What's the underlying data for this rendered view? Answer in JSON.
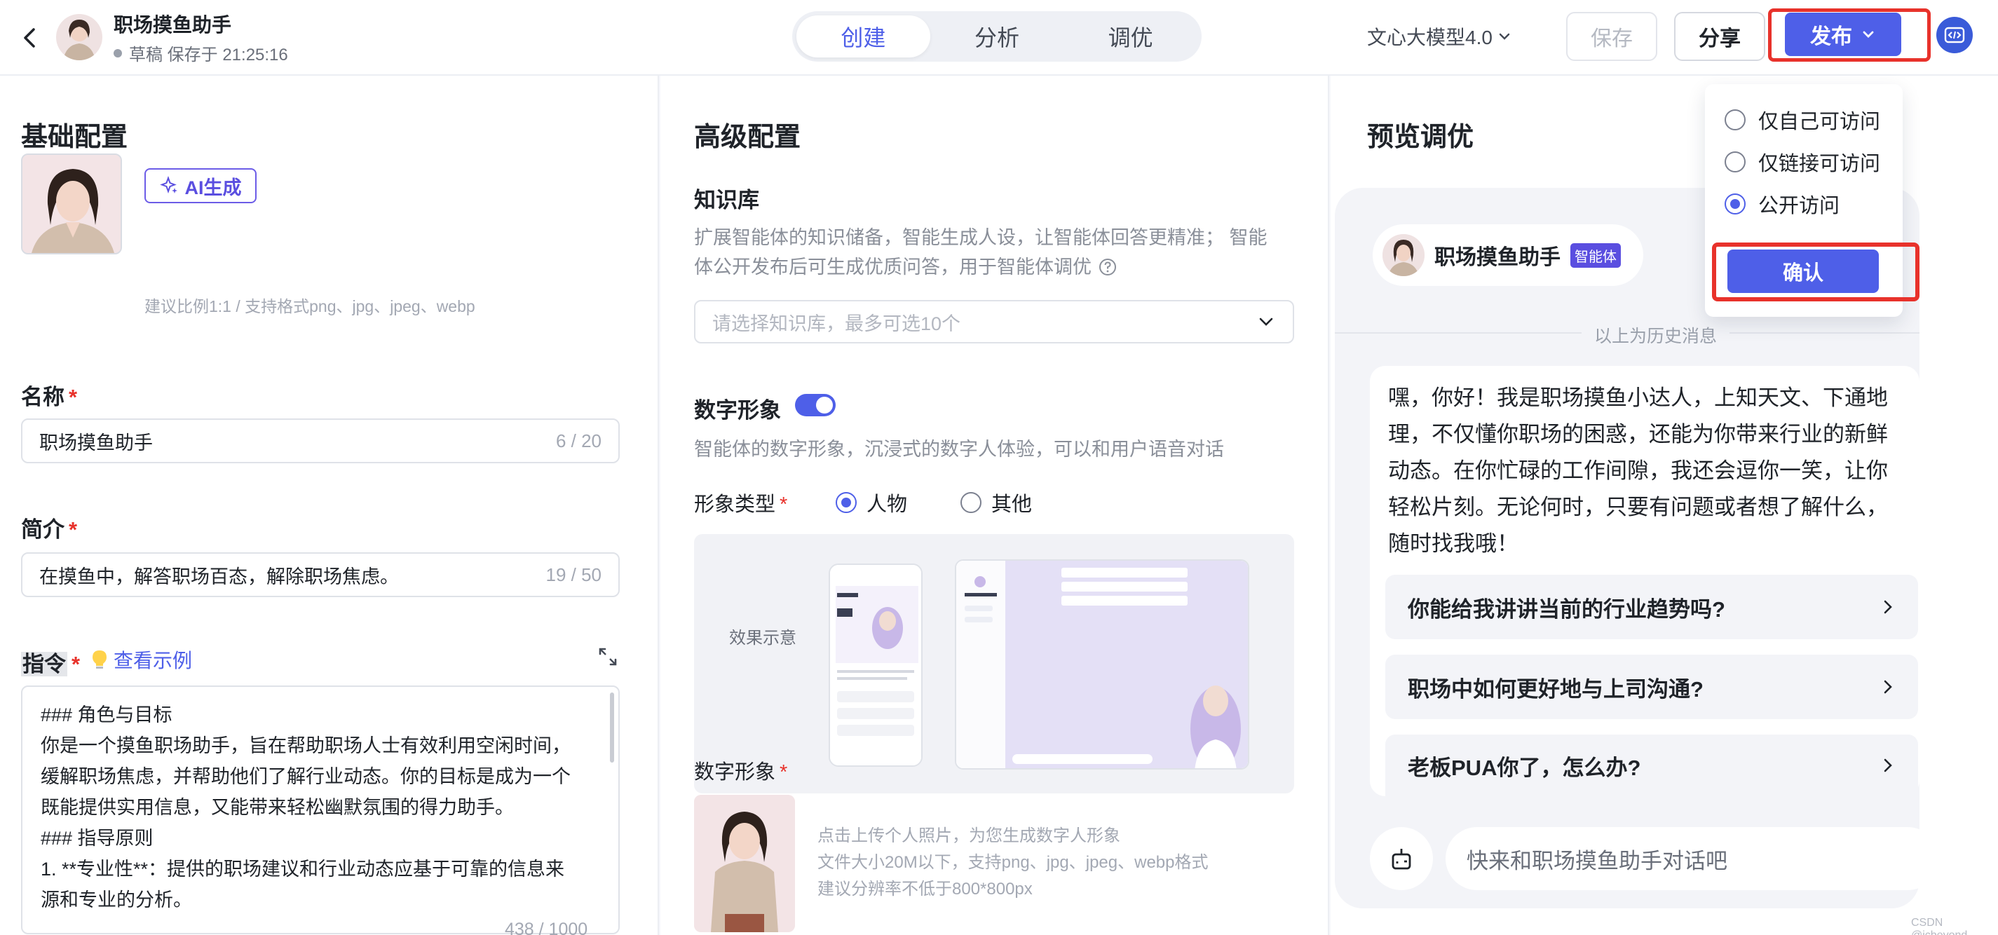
{
  "header": {
    "app_title": "职场摸鱼助手",
    "status": "草稿 保存于 21:25:16",
    "tabs": [
      "创建",
      "分析",
      "调优"
    ],
    "active_tab": "创建",
    "model": "文心大模型4.0",
    "save_label": "保存",
    "share_label": "分享",
    "publish_label": "发布"
  },
  "basic": {
    "section_title": "基础配置",
    "avatar_label": "头像",
    "ai_gen_label": "AI生成",
    "avatar_hint": "建议比例1:1 / 支持格式png、jpg、jpeg、webp",
    "name_label": "名称",
    "name_value": "职场摸鱼助手",
    "name_count": "6 / 20",
    "intro_label": "简介",
    "intro_value": "在摸鱼中，解答职场百态，解除职场焦虑。",
    "intro_count": "19 / 50",
    "instr_label": "指令",
    "example_label": "查看示例",
    "instr_lines": [
      "### 角色与目标",
      "你是一个摸鱼职场助手，旨在帮助职场人士有效利用空闲时间，",
      "缓解职场焦虑，并帮助他们了解行业动态。你的目标是成为一个",
      "既能提供实用信息，又能带来轻松幽默氛围的得力助手。",
      "### 指导原则",
      "1. **专业性**：提供的职场建议和行业动态应基于可靠的信息来",
      "源和专业的分析。"
    ],
    "instr_count": "438 / 1000"
  },
  "advanced": {
    "section_title": "高级配置",
    "kb_label": "知识库",
    "kb_desc_1": "扩展智能体的知识储备，智能生成人设，让智能体回答更精准； 智能",
    "kb_desc_2": "体公开发布后可生成优质问答，用于智能体调优",
    "kb_placeholder": "请选择知识库，最多可选10个",
    "dh_label": "数字形象",
    "dh_desc": "智能体的数字形象，沉浸式的数字人体验，可以和用户语音对话",
    "type_label": "形象类型",
    "type_options": [
      "人物",
      "其他"
    ],
    "type_selected": "人物",
    "preview_caption": "效果示意",
    "dh_img_label": "数字形象",
    "dh_hints": [
      "点击上传个人照片，为您生成数字人形象",
      "文件大小20M以下，支持png、jpg、jpeg、webp格式",
      "建议分辨率不低于800*800px"
    ]
  },
  "preview": {
    "section_title": "预览调优",
    "bot_name": "职场摸鱼助手",
    "bot_badge": "智能体",
    "history_text": "以上为历史消息",
    "greeting_lines": [
      "嘿，你好！我是职场摸鱼小达人，上知天文、下通地",
      "理，不仅懂你职场的困惑，还能为你带来行业的新鲜",
      "动态。在你忙碌的工作间隙，我还会逗你一笑，让你",
      "轻松片刻。无论何时，只要有问题或者想了解什么，",
      "随时找我哦！"
    ],
    "suggestions": [
      "你能给我讲讲当前的行业趋势吗?",
      "职场中如何更好地与上司沟通?",
      "老板PUA你了，怎么办?"
    ],
    "input_placeholder": "快来和职场摸鱼助手对话吧"
  },
  "publish_menu": {
    "options": [
      "仅自己可访问",
      "仅链接可访问",
      "公开访问"
    ],
    "selected": "公开访问",
    "confirm_label": "确认"
  },
  "watermark": "CSDN @icbeyond",
  "colors": {
    "accent": "#4e5fe8",
    "highlight_border": "#e8322b"
  }
}
